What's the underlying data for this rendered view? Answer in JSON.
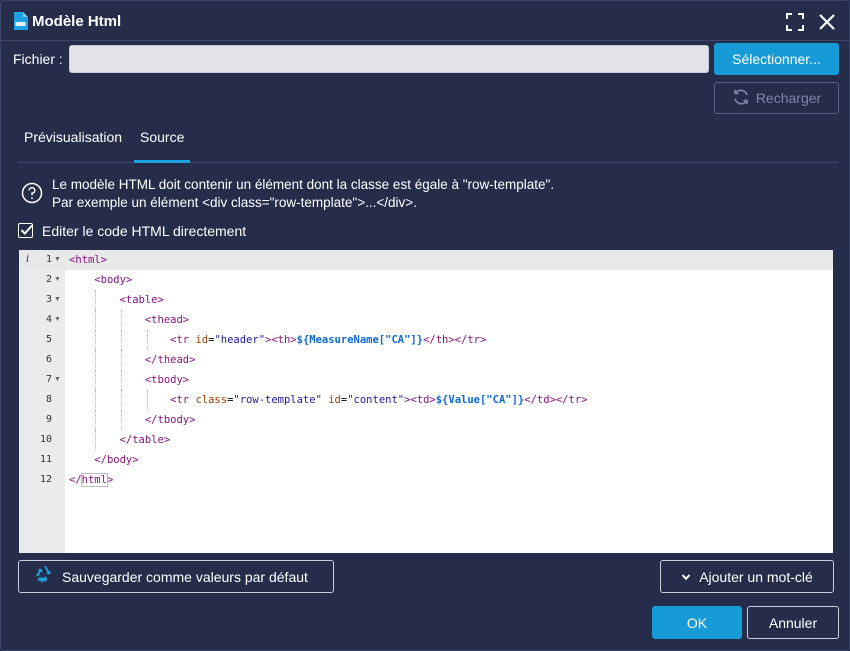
{
  "dialog": {
    "title": "Modèle Html",
    "title_icon": "html-file-icon",
    "maximize_icon": "maximize-icon",
    "close_icon": "close-icon"
  },
  "file": {
    "label": "Fichier :",
    "value": "",
    "placeholder": "",
    "select_label": "Sélectionner...",
    "reload_label": "Recharger"
  },
  "tabs": [
    {
      "label": "Prévisualisation",
      "active": false
    },
    {
      "label": "Source",
      "active": true
    }
  ],
  "info": {
    "line1": "Le modèle HTML doit contenir un élément dont la classe est égale à \"row-template\".",
    "line2": "Par exemple un élément <div class=\"row-template\">...</div>."
  },
  "edit_direct": {
    "label": "Editer le code HTML directement",
    "checked": true
  },
  "editor": {
    "lines": [
      {
        "n": "1",
        "text": "<html>"
      },
      {
        "n": "2",
        "text": "<body>"
      },
      {
        "n": "3",
        "text": "<table>"
      },
      {
        "n": "4",
        "text": "<thead>"
      },
      {
        "n": "5",
        "text": "<tr id=\"header\"><th>${MeasureName[\"CA\"]}</th></tr>"
      },
      {
        "n": "6",
        "text": "</thead>"
      },
      {
        "n": "7",
        "text": "<tbody>"
      },
      {
        "n": "8",
        "text": "<tr class=\"row-template\" id=\"content\"><td>${Value[\"CA\"]}</td></tr>"
      },
      {
        "n": "9",
        "text": "</tbody>"
      },
      {
        "n": "10",
        "text": "</table>"
      },
      {
        "n": "11",
        "text": "</body>"
      },
      {
        "n": "12",
        "text": "</html>"
      }
    ]
  },
  "footer": {
    "save_default_label": "Sauvegarder comme valeurs par défaut",
    "save_default_icon": "recycle-icon",
    "add_keyword_label": "Ajouter un mot-clé",
    "add_keyword_icon": "chevron-down-icon",
    "ok_label": "OK",
    "cancel_label": "Annuler"
  },
  "colors": {
    "background": "#252d4a",
    "accent": "#179bd7"
  }
}
